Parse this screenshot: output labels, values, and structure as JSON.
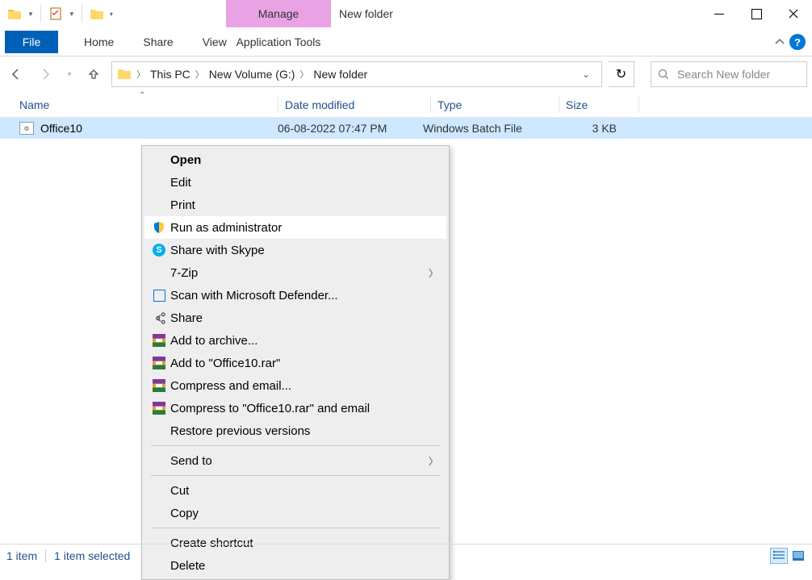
{
  "titlebar": {
    "window_title": "New folder",
    "manage_tab": "Manage"
  },
  "ribbon": {
    "file": "File",
    "home": "Home",
    "share": "Share",
    "view": "View",
    "apptools": "Application Tools"
  },
  "nav": {
    "crumb0": "This PC",
    "crumb1": "New Volume (G:)",
    "crumb2": "New folder"
  },
  "search": {
    "placeholder": "Search New folder"
  },
  "cols": {
    "name": "Name",
    "date": "Date modified",
    "type": "Type",
    "size": "Size"
  },
  "file": {
    "name": "Office10",
    "date": "06-08-2022 07:47 PM",
    "type": "Windows Batch File",
    "size": "3 KB"
  },
  "ctx": {
    "open": "Open",
    "edit": "Edit",
    "print": "Print",
    "runas": "Run as administrator",
    "skype": "Share with Skype",
    "sevenzip": "7-Zip",
    "defender": "Scan with Microsoft Defender...",
    "share": "Share",
    "addarchive": "Add to archive...",
    "addrar": "Add to \"Office10.rar\"",
    "compemail": "Compress and email...",
    "comprar": "Compress to \"Office10.rar\" and email",
    "restore": "Restore previous versions",
    "sendto": "Send to",
    "cut": "Cut",
    "copy": "Copy",
    "shortcut": "Create shortcut",
    "delete": "Delete"
  },
  "status": {
    "count": "1 item",
    "selected": "1 item selected"
  }
}
